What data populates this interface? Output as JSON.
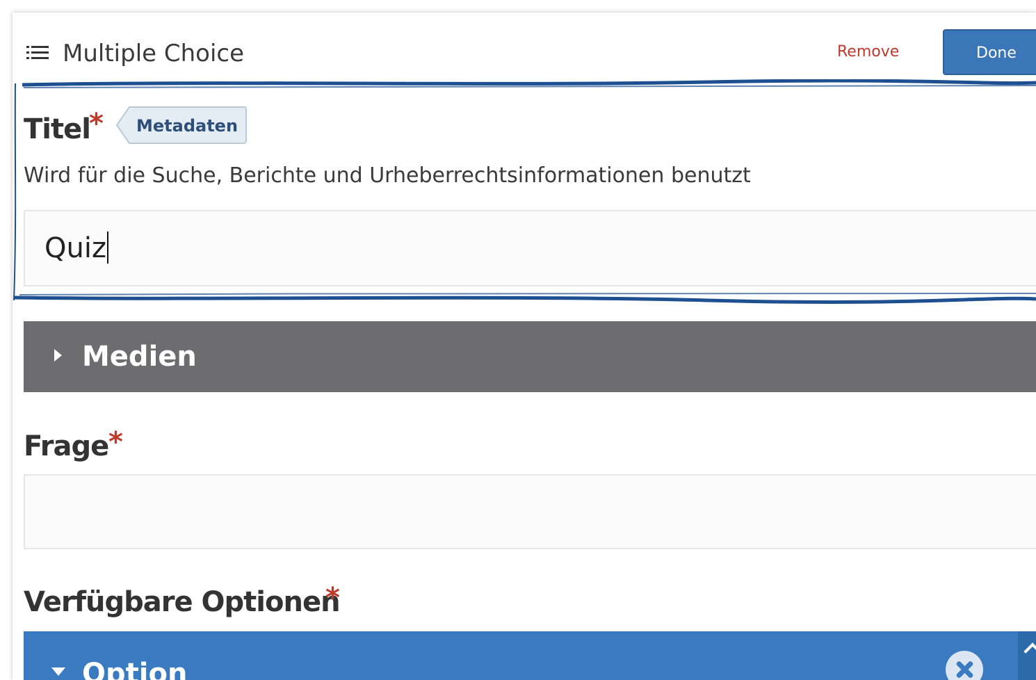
{
  "header": {
    "icon": "list-icon",
    "title": "Multiple Choice",
    "remove_label": "Remove",
    "done_label": "Done"
  },
  "title_field": {
    "label": "Titel",
    "required_mark": "*",
    "tag_label": "Metadaten",
    "description": "Wird für die Suche, Berichte und Urheberrechtsinformationen benutzt",
    "value": "Quiz"
  },
  "media_section": {
    "label": "Medien",
    "icon": "caret-right-icon"
  },
  "question_field": {
    "label": "Frage",
    "required_mark": "*",
    "value": ""
  },
  "options_field": {
    "label": "Verfügbare Optionen",
    "required_mark": "*",
    "option_label": "Option",
    "remove_icon": "close-circle-icon",
    "collapse_icon": "chevron-up-icon"
  },
  "colors": {
    "done_button": "#3a76b8",
    "remove_text": "#c0392b",
    "required_star": "#c0392b",
    "media_bar": "#6d6c6e",
    "option_bar": "#3a7ac0",
    "highlight_frame": "#1d4f91"
  }
}
